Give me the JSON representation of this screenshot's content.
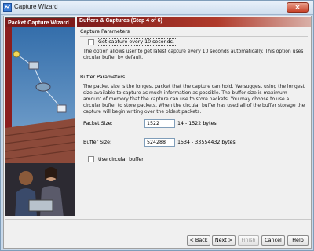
{
  "window": {
    "title": "Capture Wizard"
  },
  "banner": {
    "title": "Packet Capture Wizard"
  },
  "header": {
    "title": "Buffers & Captures  (Step 4 of 6)"
  },
  "capture_parameters": {
    "group_title": "Capture Parameters",
    "checkbox_label": "Get capture every 10 seconds.",
    "checked": false,
    "description": "The option allows user to get latest capture every 10 seconds automatically. This option uses circular buffer by default."
  },
  "buffer_parameters": {
    "group_title": "Buffer Parameters",
    "description": "The packet size is the longest packet that the capture can hold. We suggest using the longest size available to capture as much information as possible. The buffer size is maximum amount of memory that the capture can use to store packets. You may choose to use a circular buffer to store packets. When the circular buffer has used all of the buffer storage the capture will begin writing over the oldest packets.",
    "packet_size": {
      "label": "Packet Size:",
      "value": "1522",
      "range": "14 - 1522 bytes"
    },
    "buffer_size": {
      "label": "Buffer Size:",
      "value": "524288",
      "range": "1534 - 33554432 bytes"
    },
    "circular_label": "Use circular buffer",
    "circular_checked": false
  },
  "footer": {
    "back": "< Back",
    "next": "Next >",
    "finish": "Finish",
    "cancel": "Cancel",
    "help": "Help"
  },
  "colors": {
    "banner_red": "#7d1b1b",
    "titlebar": "#cfdeee",
    "close": "#c8432a"
  }
}
